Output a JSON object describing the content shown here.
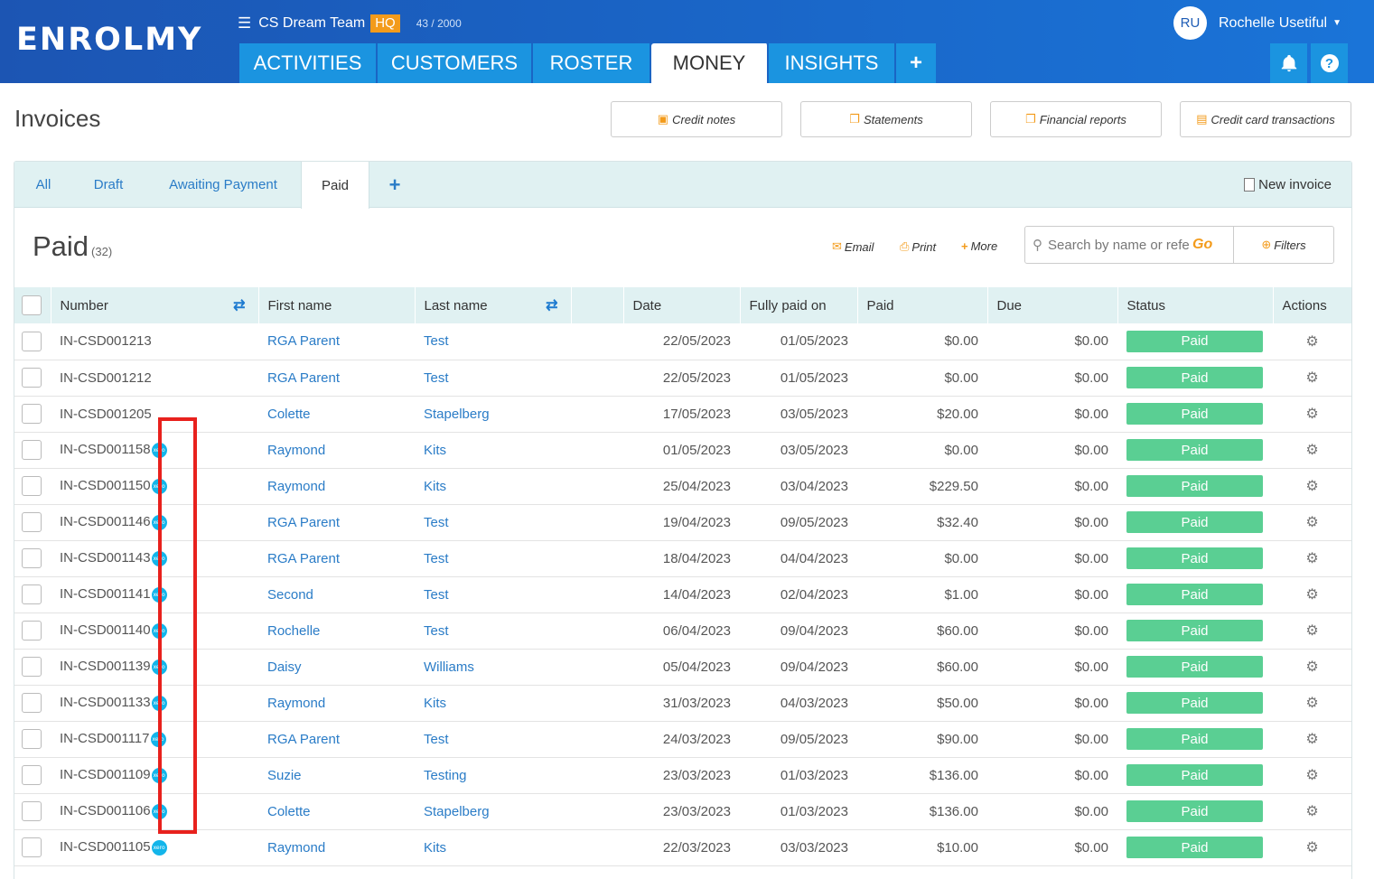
{
  "header": {
    "logo": "ENROLMY",
    "team_name": "CS Dream Team",
    "team_badge": "HQ",
    "count": "43 / 2000",
    "user_initials": "RU",
    "user_name": "Rochelle Usetiful",
    "nav_tabs": [
      {
        "label": "ACTIVITIES"
      },
      {
        "label": "CUSTOMERS"
      },
      {
        "label": "ROSTER"
      },
      {
        "label": "MONEY",
        "active": true
      },
      {
        "label": "INSIGHTS"
      },
      {
        "label": "+"
      }
    ]
  },
  "page": {
    "title": "Invoices",
    "buttons": {
      "credit_notes": "Credit notes",
      "statements": "Statements",
      "financial_reports": "Financial reports",
      "credit_card": "Credit card transactions"
    }
  },
  "subtabs": [
    {
      "label": "All"
    },
    {
      "label": "Draft"
    },
    {
      "label": "Awaiting Payment"
    },
    {
      "label": "Paid",
      "active": true
    },
    {
      "label": "+"
    }
  ],
  "new_invoice": "New invoice",
  "section": {
    "title": "Paid",
    "count": "(32)",
    "email": "Email",
    "print": "Print",
    "more": "More",
    "search_placeholder": "Search by name or refe",
    "go": "Go",
    "filters": "Filters"
  },
  "columns": {
    "number": "Number",
    "first_name": "First name",
    "last_name": "Last name",
    "date": "Date",
    "fully_paid_on": "Fully paid on",
    "paid": "Paid",
    "due": "Due",
    "status": "Status",
    "actions": "Actions"
  },
  "xero_label": "xero",
  "status_color": "#5acf93",
  "rows": [
    {
      "number": "IN-CSD001213",
      "xero": false,
      "first": "RGA Parent",
      "last": "Test",
      "date": "22/05/2023",
      "fully_paid": "01/05/2023",
      "paid": "$0.00",
      "due": "$0.00",
      "status": "Paid"
    },
    {
      "number": "IN-CSD001212",
      "xero": false,
      "first": "RGA Parent",
      "last": "Test",
      "date": "22/05/2023",
      "fully_paid": "01/05/2023",
      "paid": "$0.00",
      "due": "$0.00",
      "status": "Paid"
    },
    {
      "number": "IN-CSD001205",
      "xero": false,
      "first": "Colette",
      "last": "Stapelberg",
      "date": "17/05/2023",
      "fully_paid": "03/05/2023",
      "paid": "$20.00",
      "due": "$0.00",
      "status": "Paid"
    },
    {
      "number": "IN-CSD001158",
      "xero": true,
      "first": "Raymond",
      "last": "Kits",
      "date": "01/05/2023",
      "fully_paid": "03/05/2023",
      "paid": "$0.00",
      "due": "$0.00",
      "status": "Paid"
    },
    {
      "number": "IN-CSD001150",
      "xero": true,
      "first": "Raymond",
      "last": "Kits",
      "date": "25/04/2023",
      "fully_paid": "03/04/2023",
      "paid": "$229.50",
      "due": "$0.00",
      "status": "Paid"
    },
    {
      "number": "IN-CSD001146",
      "xero": true,
      "first": "RGA Parent",
      "last": "Test",
      "date": "19/04/2023",
      "fully_paid": "09/05/2023",
      "paid": "$32.40",
      "due": "$0.00",
      "status": "Paid"
    },
    {
      "number": "IN-CSD001143",
      "xero": true,
      "first": "RGA Parent",
      "last": "Test",
      "date": "18/04/2023",
      "fully_paid": "04/04/2023",
      "paid": "$0.00",
      "due": "$0.00",
      "status": "Paid"
    },
    {
      "number": "IN-CSD001141",
      "xero": true,
      "first": "Second",
      "last": "Test",
      "date": "14/04/2023",
      "fully_paid": "02/04/2023",
      "paid": "$1.00",
      "due": "$0.00",
      "status": "Paid"
    },
    {
      "number": "IN-CSD001140",
      "xero": true,
      "first": "Rochelle",
      "last": "Test",
      "date": "06/04/2023",
      "fully_paid": "09/04/2023",
      "paid": "$60.00",
      "due": "$0.00",
      "status": "Paid"
    },
    {
      "number": "IN-CSD001139",
      "xero": true,
      "first": "Daisy",
      "last": "Williams",
      "date": "05/04/2023",
      "fully_paid": "09/04/2023",
      "paid": "$60.00",
      "due": "$0.00",
      "status": "Paid"
    },
    {
      "number": "IN-CSD001133",
      "xero": true,
      "first": "Raymond",
      "last": "Kits",
      "date": "31/03/2023",
      "fully_paid": "04/03/2023",
      "paid": "$50.00",
      "due": "$0.00",
      "status": "Paid"
    },
    {
      "number": "IN-CSD001117",
      "xero": true,
      "first": "RGA Parent",
      "last": "Test",
      "date": "24/03/2023",
      "fully_paid": "09/05/2023",
      "paid": "$90.00",
      "due": "$0.00",
      "status": "Paid"
    },
    {
      "number": "IN-CSD001109",
      "xero": true,
      "first": "Suzie",
      "last": "Testing",
      "date": "23/03/2023",
      "fully_paid": "01/03/2023",
      "paid": "$136.00",
      "due": "$0.00",
      "status": "Paid"
    },
    {
      "number": "IN-CSD001106",
      "xero": true,
      "first": "Colette",
      "last": "Stapelberg",
      "date": "23/03/2023",
      "fully_paid": "01/03/2023",
      "paid": "$136.00",
      "due": "$0.00",
      "status": "Paid"
    },
    {
      "number": "IN-CSD001105",
      "xero": true,
      "first": "Raymond",
      "last": "Kits",
      "date": "22/03/2023",
      "fully_paid": "03/03/2023",
      "paid": "$10.00",
      "due": "$0.00",
      "status": "Paid"
    }
  ]
}
